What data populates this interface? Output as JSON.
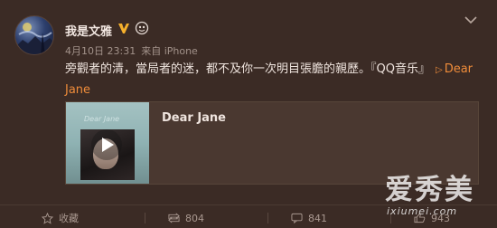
{
  "post": {
    "username": "我是文雅",
    "date": "4月10日 23:31",
    "source": "来自 iPhone",
    "text_main": "旁觀者的清，當局者的迷，都不及你一次明目張膽的親歷。",
    "text_tag": "『QQ音乐』",
    "link_part1": "Dear",
    "link_part2": "Jane"
  },
  "attachment": {
    "title": "Dear Jane",
    "thumb_caption": "Dear Jane"
  },
  "actions": {
    "favorite_label": "收藏",
    "repost_count": "804",
    "comment_count": "841",
    "like_count": "943"
  },
  "watermark": {
    "cn": "爱秀美",
    "en": "ixiumei.com"
  },
  "colors": {
    "background": "#3b2b25",
    "link": "#ef8c3a",
    "verified_badge": "#f6b02c"
  }
}
